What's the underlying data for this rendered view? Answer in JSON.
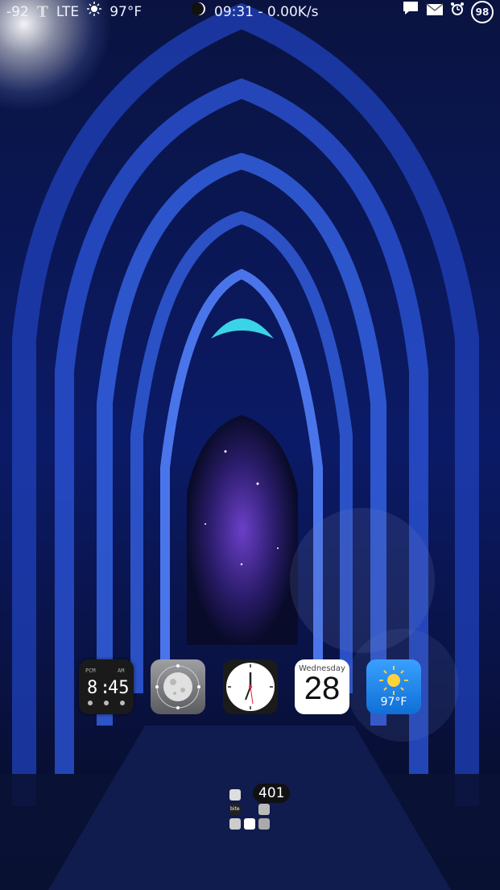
{
  "statusbar": {
    "signal": "-92",
    "carrier_icon": "T",
    "network": "LTE",
    "weather_icon": "sun-icon",
    "temperature": "97°F",
    "moon_icon": "moon-phase-icon",
    "time_speed": "09:31 - 0.00K/s",
    "notifications": [
      "chat-bubble-icon",
      "mail-icon",
      "alarm-clock-icon"
    ],
    "battery": "98"
  },
  "dock": {
    "apps": [
      {
        "name": "digital-clock-widget",
        "time_h": "8",
        "time_m": "45",
        "top_left": "PCM",
        "top_right": "AM"
      },
      {
        "name": "moon-phase-app"
      },
      {
        "name": "analog-clock-app"
      },
      {
        "name": "calendar-app",
        "weekday": "Wednesday",
        "day": "28"
      },
      {
        "name": "weather-app",
        "temp": "97°F"
      }
    ]
  },
  "folder": {
    "badge": "401",
    "label": "bite"
  },
  "colors": {
    "wall_dark": "#05081a",
    "wall_blue": "#1b3fb0",
    "accent_cyan": "#39d4e8"
  }
}
